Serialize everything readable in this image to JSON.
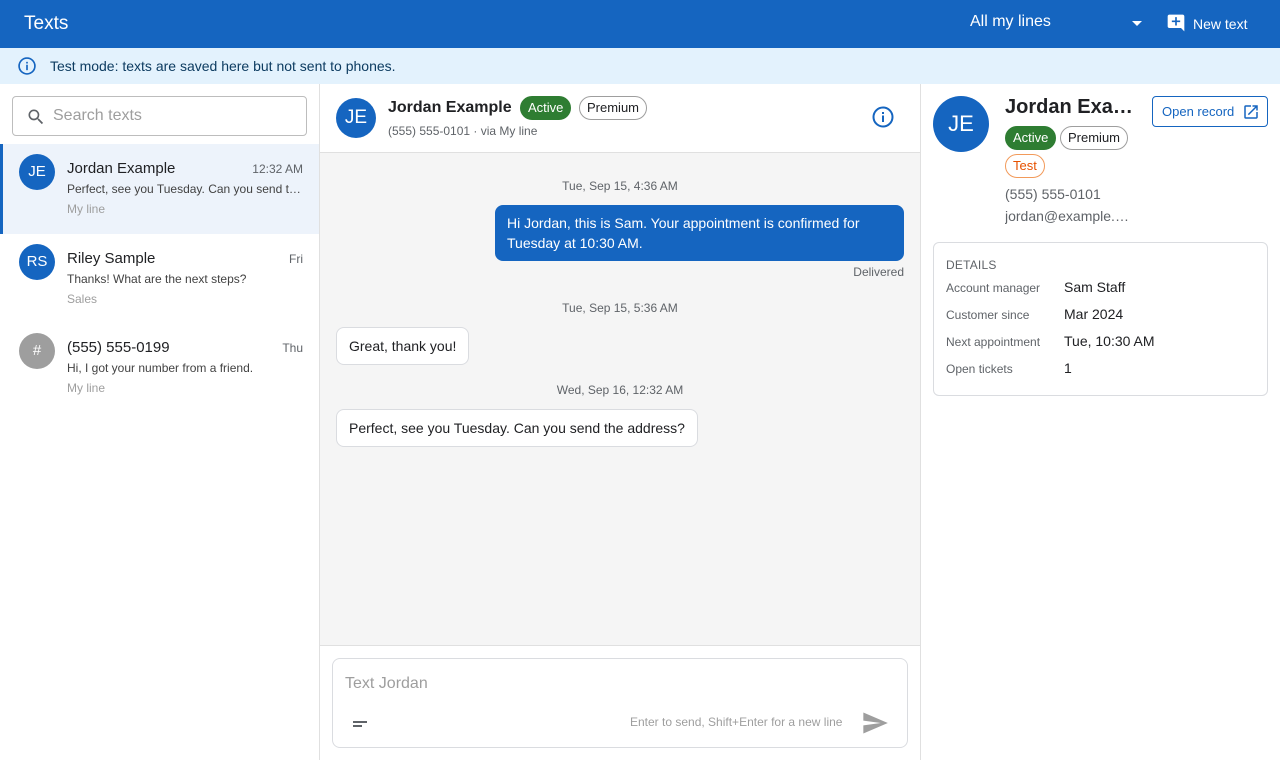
{
  "app": {
    "title": "Texts"
  },
  "header": {
    "line_selector": "All my lines",
    "new_text_label": "New text"
  },
  "banner": {
    "text": "Test mode: texts are saved here but not sent to phones."
  },
  "search": {
    "placeholder": "Search texts"
  },
  "conversations": [
    {
      "initials": "JE",
      "avatar_color": "#1565c0",
      "name": "Jordan Example",
      "time": "12:32 AM",
      "preview": "Perfect, see you Tuesday. Can you send the address?",
      "line": "My line",
      "selected": true
    },
    {
      "initials": "RS",
      "avatar_color": "#1565c0",
      "name": "Riley Sample",
      "time": "Fri",
      "preview": "Thanks! What are the next steps?",
      "line": "Sales",
      "selected": false
    },
    {
      "initials": "#",
      "avatar_color": "#9e9e9e",
      "name": "(555) 555-0199",
      "time": "Thu",
      "preview": "Hi, I got your number from a friend.",
      "line": "My line",
      "selected": false
    }
  ],
  "chat": {
    "initials": "JE",
    "name": "Jordan Example",
    "badges": [
      "Active",
      "Premium"
    ],
    "subtitle": "(555) 555-0101 · via My line",
    "thread": [
      {
        "date": "Tue, Sep 15, 4:36 AM"
      },
      {
        "direction": "outgoing",
        "text": "Hi Jordan, this is Sam. Your appointment is confirmed for Tuesday at 10:30 AM.",
        "status": "Delivered"
      },
      {
        "date": "Tue, Sep 15, 5:36 AM"
      },
      {
        "direction": "incoming",
        "text": "Great, thank you!"
      },
      {
        "date": "Wed, Sep 16, 12:32 AM"
      },
      {
        "direction": "incoming",
        "text": "Perfect, see you Tuesday. Can you send the address?"
      }
    ],
    "composer_placeholder": "Text Jordan",
    "composer_hint": "Enter to send, Shift+Enter for a new line"
  },
  "profile": {
    "initials": "JE",
    "name": "Jordan Example",
    "open_record_label": "Open record",
    "badges": [
      "Active",
      "Premium",
      "Test"
    ],
    "phone": "(555) 555-0101",
    "email": "jordan@example.com",
    "details_heading": "DETAILS",
    "details": [
      {
        "label": "Account manager",
        "value": "Sam Staff"
      },
      {
        "label": "Customer since",
        "value": "Mar 2024"
      },
      {
        "label": "Next appointment",
        "value": "Tue, 10:30 AM"
      },
      {
        "label": "Open tickets",
        "value": "1"
      }
    ]
  },
  "colors": {
    "primary": "#1565c0",
    "banner_bg": "#e3f2fd",
    "active_badge": "#2e7d32",
    "test_badge": "#e65100"
  }
}
